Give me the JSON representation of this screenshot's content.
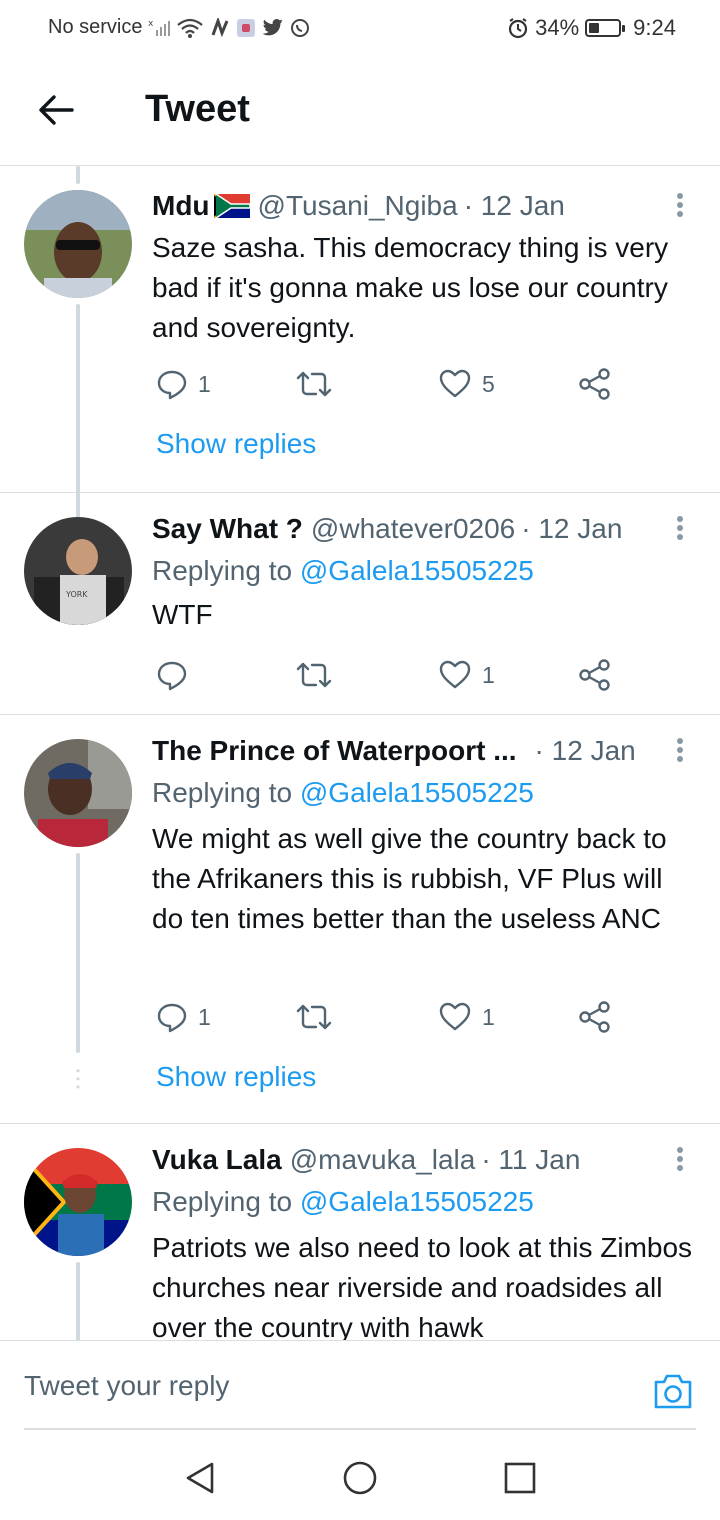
{
  "status_bar": {
    "carrier": "No service",
    "battery_percent": "34%",
    "battery_level": 0.34,
    "time": "9:24"
  },
  "header": {
    "title": "Tweet"
  },
  "tweets": [
    {
      "name": "Mdu",
      "flag": "south-africa-flag",
      "handle": "@Tusani_Ngiba",
      "date": "· 12 Jan",
      "body": "Saze sasha. This democracy thing is very bad if it's gonna make us lose our country and sovereignty.",
      "replies": "1",
      "retweets": "",
      "likes": "5",
      "show_replies": "Show replies"
    },
    {
      "name": "Say What ?",
      "handle": "@whatever0206",
      "date": "· 12 Jan",
      "replying_prefix": "Replying to",
      "replying_to": "@Galela15505225",
      "body": "WTF",
      "replies": "",
      "retweets": "",
      "likes": "1"
    },
    {
      "name": "The Prince of Waterpoort ...",
      "handle": "",
      "date": "· 12 Jan",
      "replying_prefix": "Replying to",
      "replying_to": "@Galela15505225",
      "body": "We might as well give the country back to the Afrikaners this is rubbish,  VF Plus will do ten times better than the useless ANC",
      "replies": "1",
      "retweets": "",
      "likes": "1",
      "show_replies": "Show replies"
    },
    {
      "name": "Vuka Lala",
      "handle": "@mavuka_lala",
      "date": "· 11 Jan",
      "replying_prefix": "Replying to",
      "replying_to": "@Galela15505225",
      "body": "Patriots we also need to look at this Zimbos churches near riverside and roadsides all over the country with hawk"
    }
  ],
  "reply_bar": {
    "placeholder": "Tweet your reply"
  },
  "colors": {
    "accent": "#1d9bf0",
    "text": "#0f1419",
    "secondary": "#536471",
    "divider": "#dcdfe2"
  }
}
